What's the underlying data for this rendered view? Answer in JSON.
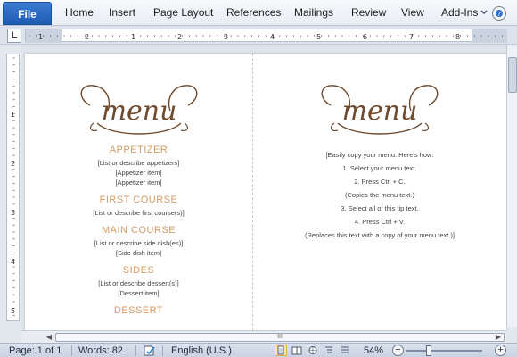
{
  "ribbon": {
    "tabs": [
      "File",
      "Home",
      "Insert",
      "Page Layout",
      "References",
      "Mailings",
      "Review",
      "View",
      "Add-Ins"
    ]
  },
  "ruler": {
    "tab_selector_glyph": "L",
    "h_numbers": [
      "1",
      "2",
      "1",
      "2",
      "3",
      "4",
      "5",
      "6",
      "7",
      "8"
    ],
    "v_numbers": [
      "1",
      "2",
      "3",
      "4",
      "5"
    ]
  },
  "document": {
    "left": {
      "logo_text": "menu",
      "sections": [
        {
          "heading": "APPETIZER",
          "lines": [
            "[List or describe appetizers]",
            "[Appetizer item]",
            "[Appetizer item]"
          ]
        },
        {
          "heading": "FIRST COURSE",
          "lines": [
            "[List or describe first course(s)]"
          ]
        },
        {
          "heading": "MAIN COURSE",
          "lines": [
            "[List or describe side dish(es)]",
            "[Side dish item]"
          ]
        },
        {
          "heading": "SIDES",
          "lines": [
            "[List or describe dessert(s)]",
            "[Dessert item]"
          ]
        },
        {
          "heading": "DESSERT",
          "lines": []
        }
      ]
    },
    "right": {
      "logo_text": "menu",
      "tips": [
        "[Easily copy your menu. Here's how:",
        "1. Select your menu text.",
        "2. Press Ctrl + C.",
        "(Copies the menu text.)",
        "3. Select all of this tip text.",
        "4. Press Ctrl + V.",
        "(Replaces this text with a copy of your menu text.)]"
      ]
    }
  },
  "hscroll": {
    "thumb_grip": "III"
  },
  "statusbar": {
    "page": "Page: 1 of 1",
    "words": "Words: 82",
    "language": "English (U.S.)",
    "zoom": "54%",
    "zoom_minus": "−",
    "zoom_plus": "+"
  },
  "colors": {
    "accent": "#d29b62",
    "logo": "#6e4a2e",
    "file_tab": "#2a66c0"
  }
}
